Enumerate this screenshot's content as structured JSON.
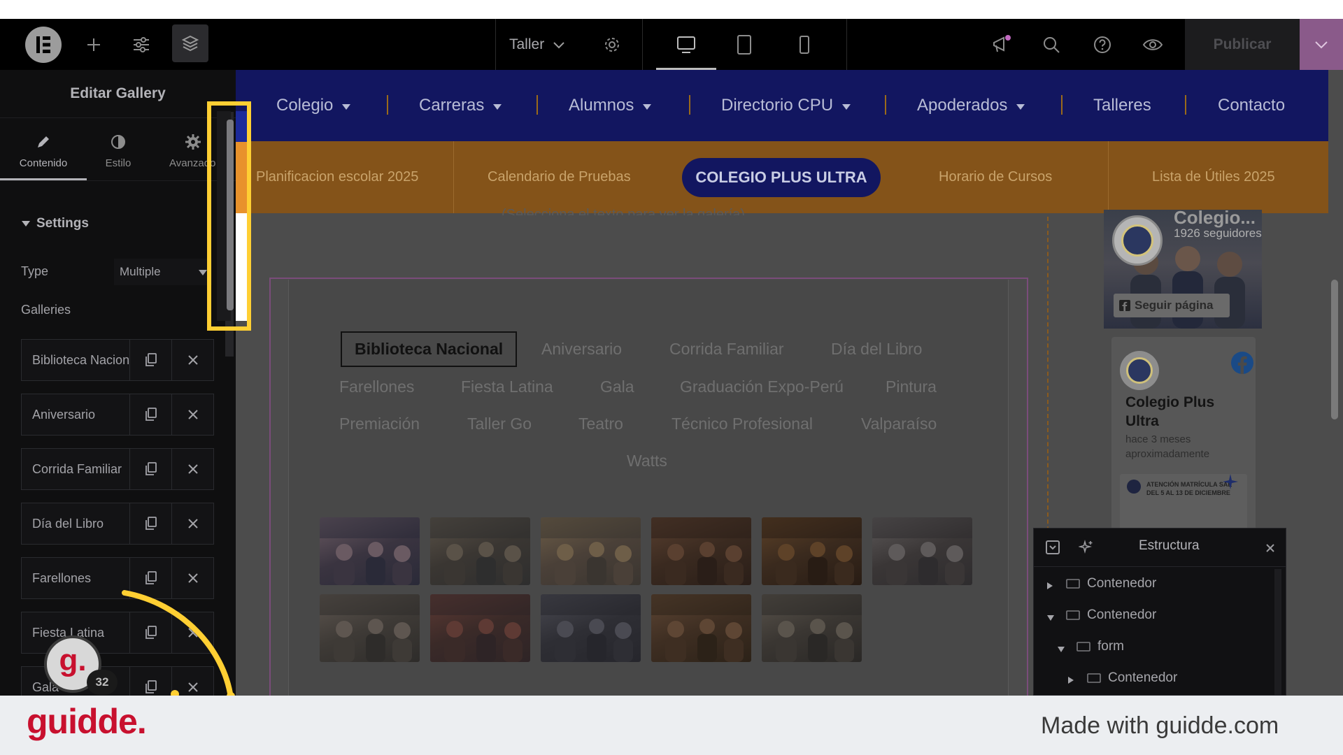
{
  "topbar": {
    "page_name": "Taller",
    "publish_label": "Publicar"
  },
  "panel": {
    "title": "Editar Gallery",
    "tabs": [
      {
        "label": "Contenido",
        "icon": "pencil-icon",
        "active": true
      },
      {
        "label": "Estilo",
        "icon": "half-circle-icon",
        "active": false
      },
      {
        "label": "Avanzado",
        "icon": "gear-icon",
        "active": false
      }
    ],
    "section_title": "Settings",
    "type_label": "Type",
    "type_value": "Multiple",
    "galleries_label": "Galleries",
    "galleries": [
      "Biblioteca Nacional",
      "Aniversario",
      "Corrida Familiar",
      "Día del Libro",
      "Farellones",
      "Fiesta Latina",
      "Gala"
    ]
  },
  "site": {
    "nav": [
      "Colegio",
      "Carreras",
      "Alumnos",
      "Directorio CPU",
      "Apoderados",
      "Talleres",
      "Contacto"
    ],
    "subnav": [
      "Planificacion escolar 2025",
      "Calendario de Pruebas",
      "COLEGIO PLUS ULTRA",
      "Horario de Cursos",
      "Lista de Útiles 2025"
    ],
    "hint_text": "(Selecciona el texto para ver la galería)",
    "gallery_tabs": [
      "Biblioteca Nacional",
      "Aniversario",
      "Corrida Familiar",
      "Día del Libro",
      "Farellones",
      "Fiesta Latina",
      "Gala",
      "Graduación Expo-Perú",
      "Pintura",
      "Premiación",
      "Taller Go",
      "Teatro",
      "Técnico Profesional",
      "Valparaíso",
      "Watts"
    ]
  },
  "facebook": {
    "page_name_short": "Colegio...",
    "followers": "1926 seguidores",
    "follow_label": "Seguir página",
    "post_author": "Colegio Plus Ultra",
    "post_time": "hace 3 meses aproximadamente",
    "post_snippet_1": "ATENCIÓN MATRÍCULA SAE",
    "post_snippet_2": "DEL 5 AL 13 DE DICIEMBRE"
  },
  "estructura": {
    "title": "Estructura",
    "rows": [
      {
        "label": "Contenedor",
        "depth": 0,
        "expanded": false
      },
      {
        "label": "Contenedor",
        "depth": 0,
        "expanded": true
      },
      {
        "label": "form",
        "depth": 1,
        "expanded": true
      },
      {
        "label": "Contenedor",
        "depth": 2,
        "expanded": false
      }
    ]
  },
  "guidde": {
    "badge_count": "32",
    "logo_text": "guidde.",
    "made_with": "Made with guidde.com"
  },
  "colors": {
    "highlight": "#ffcf33",
    "brand_red": "#c8102e",
    "publish_bg": "#8a5a8a"
  }
}
